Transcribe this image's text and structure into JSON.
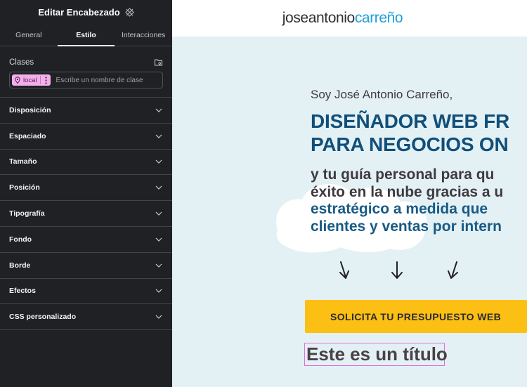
{
  "panel": {
    "title": "Editar Encabezado",
    "tabs": [
      {
        "label": "General",
        "active": false
      },
      {
        "label": "Estilo",
        "active": true
      },
      {
        "label": "Interacciones",
        "active": false
      }
    ],
    "classes": {
      "label": "Clases",
      "chip_label": "local",
      "input_placeholder": "Escribe un nombre de clase"
    },
    "sections": [
      {
        "label": "Disposición"
      },
      {
        "label": "Espaciado"
      },
      {
        "label": "Tamaño"
      },
      {
        "label": "Posición"
      },
      {
        "label": "Tipografía"
      },
      {
        "label": "Fondo"
      },
      {
        "label": "Borde"
      },
      {
        "label": "Efectos"
      },
      {
        "label": "CSS personalizado"
      }
    ],
    "icons": {
      "title": "widget-settings-icon",
      "classes": "folder-icon",
      "chip": "location-pin-icon",
      "section": "chevron-down-icon",
      "collapse": "chevron-left-icon"
    }
  },
  "site": {
    "logo_first": "joseantonio",
    "logo_last": "carreño",
    "intro": "Soy José Antonio Carreño,",
    "headline": [
      "DISEÑADOR WEB FR",
      "PARA NEGOCIOS ON"
    ],
    "subtext_dark": [
      "y tu guía personal para qu",
      "éxito en la nube gracias a u"
    ],
    "subtext_blue": [
      "estratégico a medida que",
      "clientes y ventas por intern"
    ],
    "cta_label": "SOLICITA TU PRESUPUESTO WEB",
    "sample_title": "Este es un título"
  },
  "colors": {
    "panel_bg": "#1f2124",
    "brand_blue": "#1ea0d6",
    "headline_blue": "#114f79",
    "cta_yellow": "#fcbf13",
    "chip_pink": "#f2b0ea",
    "selection_outline": "#e36bdf",
    "canvas_bg": "#e3f1f5"
  }
}
